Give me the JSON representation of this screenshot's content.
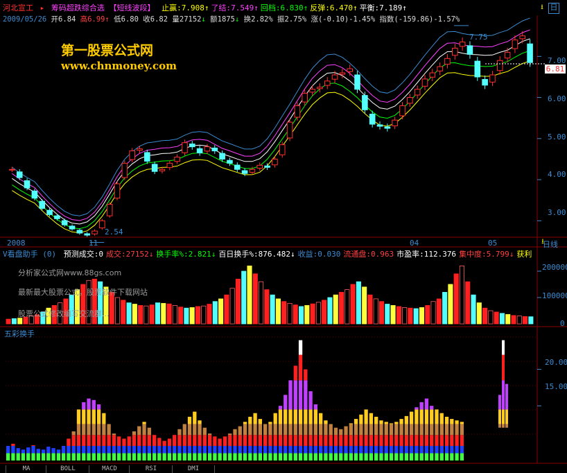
{
  "header": {
    "stock_name": "河北宣工",
    "formula": "筹码超跌综合选 【短线波段】",
    "items": [
      {
        "label": "止赢",
        "value": ":7.908",
        "arrow": "↑",
        "color": "#ffff00"
      },
      {
        "label": "了结",
        "value": ":7.549",
        "arrow": "↑",
        "color": "#ff40ff"
      },
      {
        "label": "回档",
        "value": ":6.830",
        "arrow": "↑",
        "color": "#00ff00"
      },
      {
        "label": "反弹",
        "value": ":6.470",
        "arrow": "↑",
        "color": "#ffff00"
      },
      {
        "label": "平衡",
        "value": ":7.189",
        "arrow": "↑",
        "color": "#ffffff"
      }
    ]
  },
  "quote": {
    "date": "2009/05/26",
    "open": "开6.84",
    "high": "高6.99",
    "low": "低6.80",
    "close": "收6.82",
    "volume": "量27152",
    "amount": "额1875",
    "turnover": "换2.82%",
    "amplitude": "振2.75%",
    "change": "涨(-0.10)-1.45%",
    "index": "指数(-159.86)-1.57%"
  },
  "watermark": {
    "site_name": "第一股票公式网",
    "site_url": "www.chnmoney.com",
    "lines": [
      "分析家公式网www.88gs.com",
      "最新最大股票公式，股票软件下载网站",
      "股票公式修改编写交流群..."
    ]
  },
  "price_axis": {
    "labels": [
      "7.00",
      "6.00",
      "5.00",
      "4.00",
      "3.00"
    ],
    "current": "6.81",
    "ylim": [
      2.6,
      7.9
    ]
  },
  "price_annotations": {
    "high": "7.75",
    "low": "2.54"
  },
  "time_axis": {
    "labels": [
      "2008",
      "11",
      "04",
      "05"
    ],
    "unit_label": "日线"
  },
  "volume_panel": {
    "title": "V看盘助手 (0)",
    "items": [
      {
        "text": "预测成交:0",
        "color": "#ffffff"
      },
      {
        "text": "成交:27152↓",
        "color": "#ff4040"
      },
      {
        "text": "换手率%:2.821↓",
        "color": "#00ff00"
      },
      {
        "text": "百日换手%:876.482↓",
        "color": "#ffffff"
      },
      {
        "text": "收益:0.030",
        "color": "#3b8bd1"
      },
      {
        "text": "流通盘:0.963",
        "color": "#ff4040"
      },
      {
        "text": "市盈率:112.376",
        "color": "#ffffff"
      },
      {
        "text": "集中度:5.799↓",
        "color": "#ff4040"
      },
      {
        "text": "获利",
        "color": "#ffff00"
      }
    ],
    "axis_labels": [
      "200000",
      "100000",
      "0"
    ]
  },
  "turnover_panel": {
    "title": "五彩换手",
    "axis_labels": [
      "20.00",
      "15.00"
    ]
  },
  "tabs": [
    "MA",
    "BOLL",
    "MACD",
    "RSI",
    "DMI"
  ],
  "chart_data": [
    {
      "type": "candlestick",
      "title": "河北宣工",
      "ylim": [
        2.6,
        7.9
      ],
      "series": [
        {
          "name": "止赢",
          "color": "#ffff00"
        },
        {
          "name": "了结",
          "color": "#ff40ff"
        },
        {
          "name": "回档",
          "color": "#00ff00"
        },
        {
          "name": "反弹",
          "color": "#ffff00"
        },
        {
          "name": "平衡",
          "color": "#ffffff"
        }
      ],
      "close": [
        4.25,
        4.05,
        3.8,
        3.55,
        3.3,
        3.15,
        3.05,
        2.9,
        2.8,
        2.7,
        2.65,
        2.75,
        3.0,
        3.4,
        3.9,
        4.4,
        4.7,
        4.75,
        4.45,
        4.2,
        4.25,
        4.4,
        4.55,
        4.9,
        4.8,
        4.65,
        4.8,
        4.7,
        4.5,
        4.4,
        4.25,
        4.15,
        4.25,
        4.35,
        4.3,
        4.5,
        4.85,
        5.4,
        5.8,
        6.1,
        6.2,
        6.25,
        6.4,
        6.55,
        6.6,
        6.7,
        6.2,
        5.7,
        5.35,
        5.3,
        5.25,
        5.45,
        5.8,
        6.0,
        6.2,
        6.45,
        6.6,
        6.75,
        6.95,
        7.2,
        7.35,
        7.05,
        6.5,
        6.3,
        6.55,
        6.9,
        7.1,
        7.4,
        7.5,
        6.85
      ]
    },
    {
      "type": "bar",
      "title": "V看盘助手",
      "ylim": [
        0,
        250000
      ],
      "values": [
        18000,
        20000,
        22000,
        26000,
        30000,
        35000,
        45000,
        60000,
        70000,
        80000,
        95000,
        110000,
        130000,
        150000,
        165000,
        170000,
        160000,
        140000,
        120000,
        100000,
        90000,
        80000,
        75000,
        70000,
        68000,
        72000,
        80000,
        78000,
        76000,
        70000,
        64000,
        60000,
        62000,
        66000,
        68000,
        75000,
        85000,
        95000,
        110000,
        135000,
        170000,
        200000,
        220000,
        190000,
        160000,
        130000,
        110000,
        95000,
        85000,
        78000,
        72000,
        66000,
        70000,
        76000,
        82000,
        90000,
        100000,
        110000,
        120000,
        130000,
        150000,
        160000,
        140000,
        110000,
        95000,
        85000,
        75000,
        70000,
        66000,
        62000,
        60000,
        58000,
        62000,
        70000,
        85000,
        95000,
        120000,
        150000,
        190000,
        220000,
        160000,
        110000,
        80000,
        60000,
        50000,
        45000,
        40000,
        36000,
        32000,
        30000,
        28000,
        27152
      ]
    },
    {
      "type": "bar",
      "title": "五彩换手",
      "ylim": [
        7.5,
        25
      ],
      "values": [
        9.5,
        9.8,
        9.2,
        9.0,
        9.3,
        9.6,
        9.1,
        9.0,
        9.4,
        9.2,
        9.0,
        9.5,
        10.5,
        11.5,
        14.5,
        15.5,
        16.0,
        15.8,
        15.2,
        14.0,
        12.5,
        11.2,
        10.8,
        10.5,
        10.8,
        11.5,
        12.2,
        12.8,
        12.0,
        11.0,
        10.6,
        10.2,
        10.5,
        11.0,
        11.8,
        12.5,
        13.5,
        14.2,
        13.0,
        12.0,
        11.2,
        10.8,
        10.5,
        10.8,
        11.2,
        11.8,
        12.2,
        12.8,
        13.5,
        14.0,
        13.2,
        12.5,
        12.8,
        14.0,
        15.0,
        16.5,
        18.5,
        20.5,
        24.0,
        20.0,
        17.0,
        15.2,
        14.0,
        13.0,
        12.5,
        12.0,
        11.8,
        12.2,
        12.6,
        13.2,
        13.8,
        14.5,
        14.0,
        13.5,
        13.0,
        12.8,
        12.6,
        12.8,
        13.2,
        13.6,
        14.2,
        14.8,
        15.5,
        16.0,
        15.0,
        14.5,
        14.0,
        13.5,
        13.2,
        13.0,
        12.8
      ]
    }
  ]
}
